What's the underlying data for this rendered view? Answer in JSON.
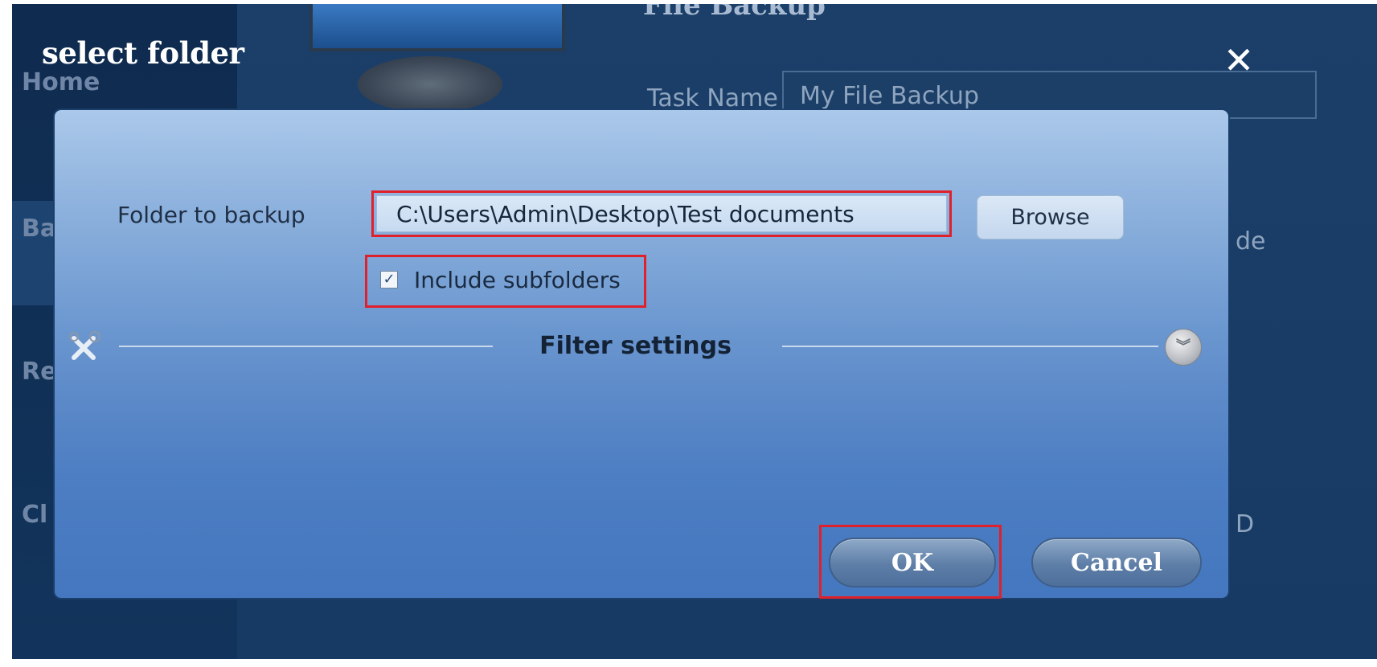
{
  "background_app": {
    "sidebar": {
      "items": [
        {
          "label": "Home"
        },
        {
          "label": "Ba"
        },
        {
          "label": "Re"
        },
        {
          "label": "Cl"
        }
      ]
    },
    "heading": "File Backup",
    "task_name_label": "Task Name",
    "task_name_value": "My File Backup",
    "right_fragment_1": "de",
    "right_fragment_2": "D"
  },
  "dialog": {
    "title": "select folder",
    "close_icon": "close-icon",
    "folder_label": "Folder to backup",
    "folder_path": "C:\\Users\\Admin\\Desktop\\Test documents",
    "browse_label": "Browse",
    "include_subfolders_label": "Include subfolders",
    "include_subfolders_checked": true,
    "filter_settings_label": "Filter settings",
    "ok_label": "OK",
    "cancel_label": "Cancel"
  },
  "colors": {
    "highlight_border": "#e0202a",
    "dialog_top": "#aac8ea",
    "dialog_bottom": "#4477bf",
    "app_background": "#0d2a4d"
  }
}
